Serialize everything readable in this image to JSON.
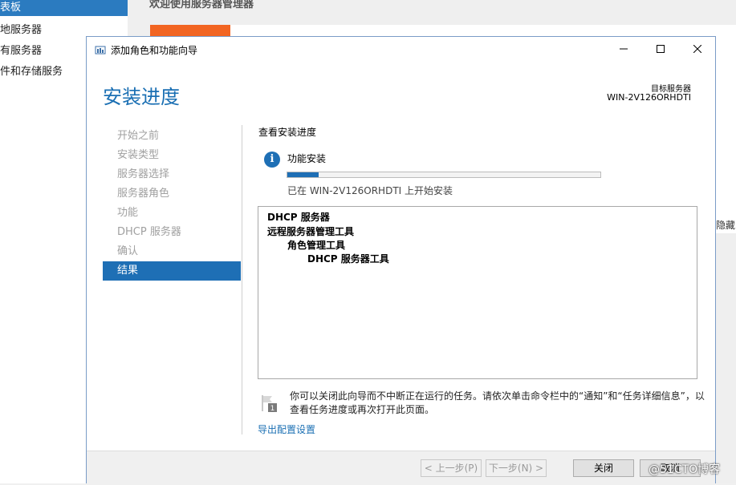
{
  "background": {
    "sidebar_items": [
      {
        "label": "表板",
        "active": true
      },
      {
        "label": "地服务器",
        "active": false
      },
      {
        "label": "有服务器",
        "active": false
      },
      {
        "label": "件和存储服务",
        "active": false
      }
    ],
    "welcome": "欢迎使用服务器管理器",
    "hide_text": "隐藏"
  },
  "dialog": {
    "title": "添加角色和功能向导",
    "heading": "安装进度",
    "target_label": "目标服务器",
    "target_name": "WIN-2V126ORHDTI",
    "nav": [
      {
        "label": "开始之前",
        "active": false
      },
      {
        "label": "安装类型",
        "active": false
      },
      {
        "label": "服务器选择",
        "active": false
      },
      {
        "label": "服务器角色",
        "active": false
      },
      {
        "label": "功能",
        "active": false
      },
      {
        "label": "DHCP 服务器",
        "active": false
      },
      {
        "label": "确认",
        "active": false
      },
      {
        "label": "结果",
        "active": true
      }
    ],
    "section_title": "查看安装进度",
    "feature_install": "功能安装",
    "progress_fraction": 0.1,
    "progress_text": "已在 WIN-2V126ORHDTI 上开始安装",
    "results": [
      {
        "text": "DHCP 服务器",
        "indent": 0
      },
      {
        "text": "远程服务器管理工具",
        "indent": 0
      },
      {
        "text": "角色管理工具",
        "indent": 1
      },
      {
        "text": "DHCP 服务器工具",
        "indent": 2
      }
    ],
    "note": "你可以关闭此向导而不中断正在运行的任务。请依次单击命令栏中的“通知”和“任务详细信息”，以查看任务进度或再次打开此页面。",
    "export_link": "导出配置设置",
    "buttons": {
      "prev": "< 上一步(P)",
      "next": "下一步(N) >",
      "close": "关闭",
      "cancel": "取消"
    }
  },
  "watermark": "@51CTO博客",
  "colors": {
    "accent": "#1e6fb5",
    "orange": "#f26522"
  }
}
